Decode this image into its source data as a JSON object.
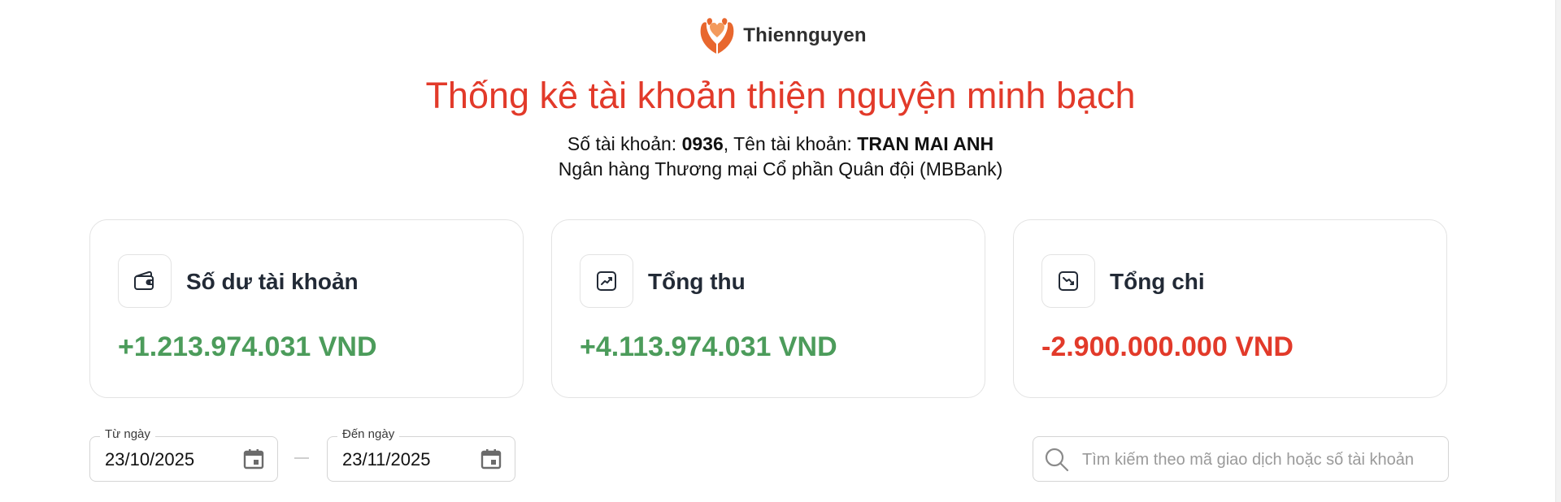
{
  "brand": {
    "name": "Thiennguyen",
    "logo_icon": "hands-heart-logo",
    "logo_color": "#e8672e"
  },
  "header": {
    "title": "Thống kê tài khoản thiện nguyện minh bạch",
    "account_number_label": "Số tài khoản:",
    "account_number": "0936",
    "account_name_label": ", Tên tài khoản:",
    "account_name": "TRAN MAI ANH",
    "bank_name": "Ngân hàng Thương mại Cổ phần Quân đội (MBBank)"
  },
  "colors": {
    "accent": "#e23a2a",
    "positive": "#4c9c5b",
    "negative": "#e23a2a"
  },
  "cards": [
    {
      "icon": "wallet-icon",
      "title": "Số dư tài khoản",
      "value": "+1.213.974.031 VND"
    },
    {
      "icon": "trending-up-icon",
      "title": "Tổng thu",
      "value": "+4.113.974.031 VND"
    },
    {
      "icon": "trending-down-icon",
      "title": "Tổng chi",
      "value": "-2.900.000.000 VND"
    }
  ],
  "filters": {
    "from_label": "Từ ngày",
    "from_value": "23/10/2025",
    "to_label": "Đến ngày",
    "to_value": "23/11/2025",
    "search_placeholder": "Tìm kiếm theo mã giao dịch hoặc số tài khoản",
    "search_value": ""
  }
}
